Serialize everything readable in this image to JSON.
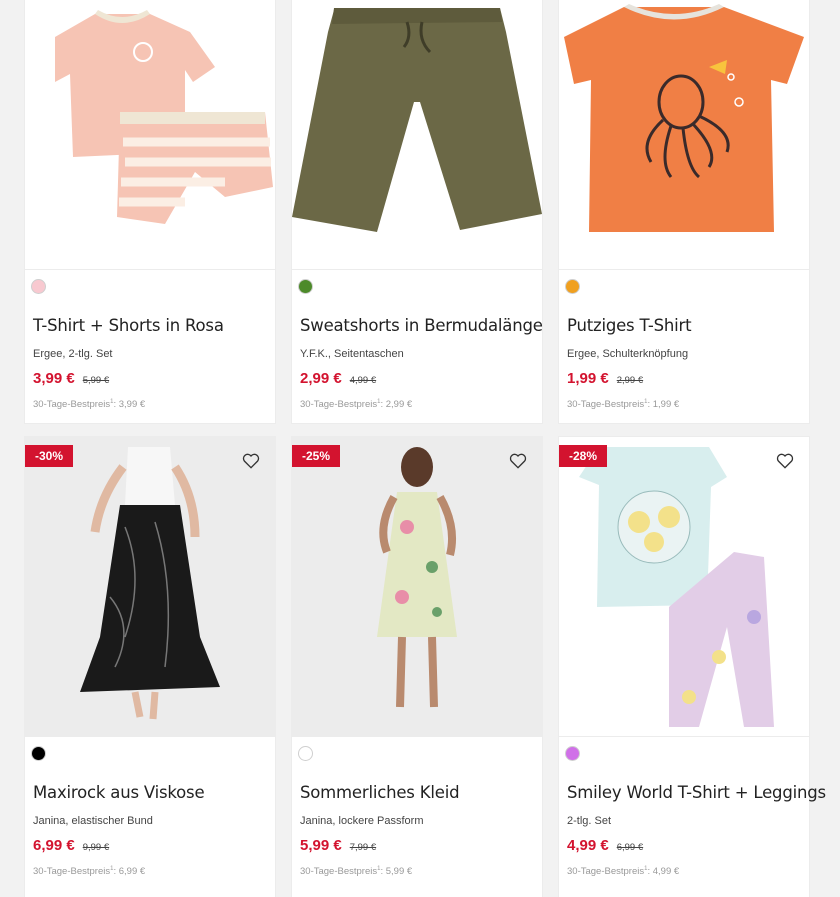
{
  "products": [
    {
      "title": "T-Shirt + Shorts in Rosa",
      "subtitle": "Ergee, 2-tlg. Set",
      "price": "3,99 €",
      "old_price": "5,99 €",
      "best_label": "30-Tage-Bestpreis",
      "best_sup": "1",
      "best_value": ": 3,99 €",
      "swatch_color": "#f8c9d0",
      "image_icon": "pink-tshirt-shorts-image"
    },
    {
      "title": "Sweatshorts in Bermudalänge",
      "subtitle": "Y.F.K., Seitentaschen",
      "price": "2,99 €",
      "old_price": "4,99 €",
      "best_label": "30-Tage-Bestpreis",
      "best_sup": "1",
      "best_value": ": 2,99 €",
      "swatch_color": "#4d8a2a",
      "image_icon": "olive-shorts-image"
    },
    {
      "title": "Putziges T-Shirt",
      "subtitle": "Ergee, Schulterknöpfung",
      "price": "1,99 €",
      "old_price": "2,99 €",
      "best_label": "30-Tage-Bestpreis",
      "best_sup": "1",
      "best_value": ": 1,99 €",
      "swatch_color": "#f0a020",
      "image_icon": "orange-octopus-tshirt-image"
    },
    {
      "badge": "-30%",
      "title": "Maxirock aus Viskose",
      "subtitle": "Janina, elastischer Bund",
      "price": "6,99 €",
      "old_price": "9,99 €",
      "best_label": "30-Tage-Bestpreis",
      "best_sup": "1",
      "best_value": ": 6,99 €",
      "swatch_color": "#000000",
      "image_icon": "black-maxi-skirt-image"
    },
    {
      "badge": "-25%",
      "title": "Sommerliches Kleid",
      "subtitle": "Janina, lockere Passform",
      "price": "5,99 €",
      "old_price": "7,99 €",
      "best_label": "30-Tage-Bestpreis",
      "best_sup": "1",
      "best_value": ": 5,99 €",
      "swatch_color": "#ffffff",
      "image_icon": "floral-summer-dress-image"
    },
    {
      "badge": "-28%",
      "title": "Smiley World T-Shirt + Leggings",
      "subtitle": "2-tlg. Set",
      "price": "4,99 €",
      "old_price": "6,99 €",
      "best_label": "30-Tage-Bestpreis",
      "best_sup": "1",
      "best_value": ": 4,99 €",
      "swatch_color": "#d070e8",
      "image_icon": "smiley-tshirt-leggings-image"
    }
  ]
}
